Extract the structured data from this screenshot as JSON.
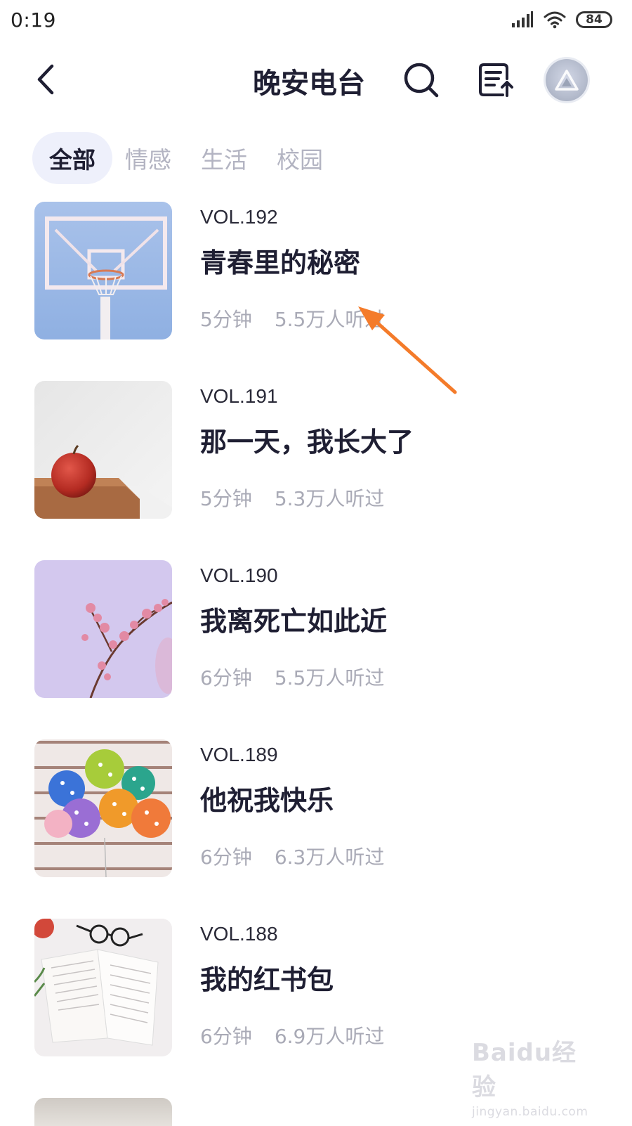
{
  "status_bar": {
    "time": "0:19",
    "battery": "84"
  },
  "header": {
    "title": "晚安电台",
    "icons": [
      "back-arrow-icon",
      "search-icon",
      "list-export-icon",
      "avatar"
    ]
  },
  "tabs": [
    {
      "label": "全部",
      "active": true
    },
    {
      "label": "情感",
      "active": false
    },
    {
      "label": "生活",
      "active": false
    },
    {
      "label": "校园",
      "active": false
    }
  ],
  "items": [
    {
      "vol": "VOL.192",
      "title": "青春里的秘密",
      "duration": "5分钟",
      "listens": "5.5万人听过",
      "image": "basketball-hoop"
    },
    {
      "vol": "VOL.191",
      "title": "那一天，我长大了",
      "duration": "5分钟",
      "listens": "5.3万人听过",
      "image": "apple-on-board"
    },
    {
      "vol": "VOL.190",
      "title": "我离死亡如此近",
      "duration": "6分钟",
      "listens": "5.5万人听过",
      "image": "blossom-branch"
    },
    {
      "vol": "VOL.189",
      "title": "他祝我快乐",
      "duration": "6分钟",
      "listens": "6.3万人听过",
      "image": "polka-dot-balloons"
    },
    {
      "vol": "VOL.188",
      "title": "我的红书包",
      "duration": "6分钟",
      "listens": "6.9万人听过",
      "image": "open-book"
    }
  ],
  "colors": {
    "title_text": "#1f1f33",
    "meta_text": "#a9aab6",
    "active_tab_bg": "#eef0fb",
    "annotation_arrow": "#f47b2a"
  },
  "watermark": {
    "logo": "Baidu经验",
    "url": "jingyan.baidu.com"
  }
}
